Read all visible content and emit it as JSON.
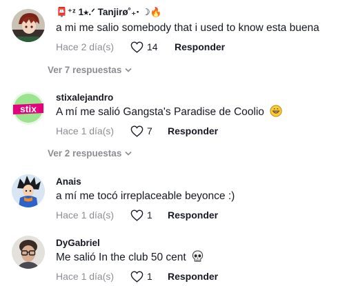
{
  "comments": [
    {
      "username": "📮⁺ᶻ 1⭑.ᐟ Tanjirø˚₊‧ ☽🔥",
      "text": "a mi me salio somebody that i used to know esta buena",
      "date": "Hace 2 día(s)",
      "likes": "14",
      "reply_label": "Responder",
      "avatar": "anime-character-avatar"
    },
    {
      "username": "stixalejandro",
      "text": "A mí me salió Gangsta's Paradise de Coolio",
      "emoji": "grinning-face-emoji",
      "date": "Hace 1 día(s)",
      "likes": "7",
      "reply_label": "Responder",
      "avatar": "stix-logo-avatar",
      "avatar_text": "stix"
    },
    {
      "username": "Anais",
      "text": "a mí me tocó irreplaceable beyonce :)",
      "date": "Hace 1 día(s)",
      "likes": "1",
      "reply_label": "Responder",
      "avatar": "goku-avatar"
    },
    {
      "username": "DyGabriel",
      "text": "Me salió In the club 50 cent",
      "emoji": "skull-emoji",
      "date": "Hace 1 día(s)",
      "likes": "1",
      "reply_label": "Responder",
      "avatar": "person-photo-avatar"
    }
  ],
  "replies": [
    {
      "label": "Ver 7 respuestas"
    },
    {
      "label": "Ver 2 respuestas"
    }
  ],
  "colors": {
    "text": "#161823",
    "muted": "rgba(22,24,35,0.5)",
    "stix_green": "#9be38f",
    "stix_magenta": "#e4007c"
  }
}
